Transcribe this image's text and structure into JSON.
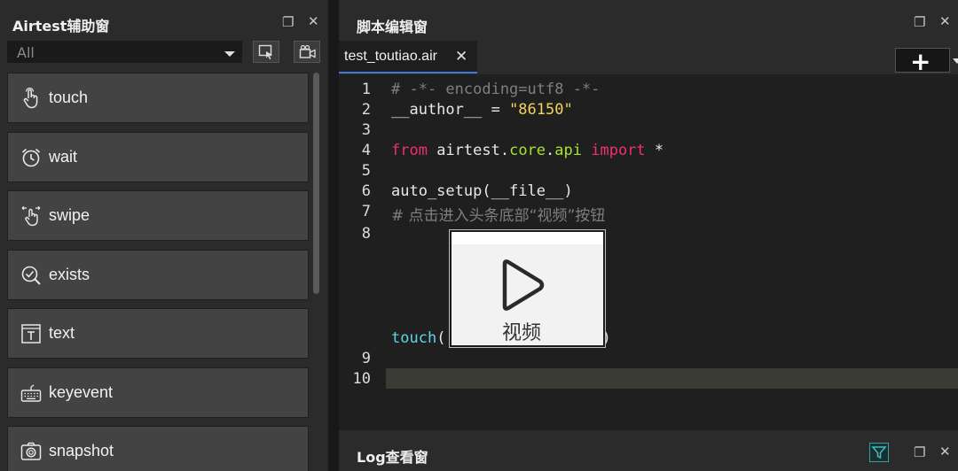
{
  "helper_panel": {
    "title": "Airtest辅助窗",
    "restore_icon": "❐",
    "close_icon": "✕",
    "filter": {
      "value": "All"
    },
    "tool_buttons": [
      "select-region-icon",
      "camera-record-icon"
    ],
    "api_items": [
      {
        "label": "touch",
        "icon": "hand-tap-icon"
      },
      {
        "label": "wait",
        "icon": "alarm-clock-icon"
      },
      {
        "label": "swipe",
        "icon": "hand-swipe-icon"
      },
      {
        "label": "exists",
        "icon": "search-check-icon"
      },
      {
        "label": "text",
        "icon": "text-box-icon"
      },
      {
        "label": "keyevent",
        "icon": "keyboard-icon"
      },
      {
        "label": "snapshot",
        "icon": "camera-icon"
      }
    ]
  },
  "editor_panel": {
    "title": "脚本编辑窗",
    "restore_icon": "❐",
    "close_icon": "✕",
    "tab": {
      "label": "test_toutiao.air",
      "close": "✕"
    },
    "add_button": {
      "symbol": "+"
    },
    "line_numbers": [
      "1",
      "2",
      "3",
      "4",
      "5",
      "6",
      "7",
      "8",
      "9",
      "10"
    ],
    "code": {
      "l1": "# -*- encoding=utf8 -*-",
      "l2_name": "__author__ = ",
      "l2_str": "\"86150\"",
      "l4_from": "from",
      "l4_pkg": " airtest.",
      "l4_core": "core",
      "l4_dot": ".",
      "l4_api": "api",
      "l4_import": " import",
      "l4_star": " *",
      "l6": "auto_setup(__file__)",
      "l7": "# 点击进入头条底部“视频”按钮",
      "l8_fn": "touch",
      "l8_open": "(",
      "l8_close": ")"
    },
    "image_thumb": {
      "caption": "视频"
    }
  },
  "log_panel": {
    "title": "Log查看窗",
    "restore_icon": "❐",
    "close_icon": "✕"
  }
}
